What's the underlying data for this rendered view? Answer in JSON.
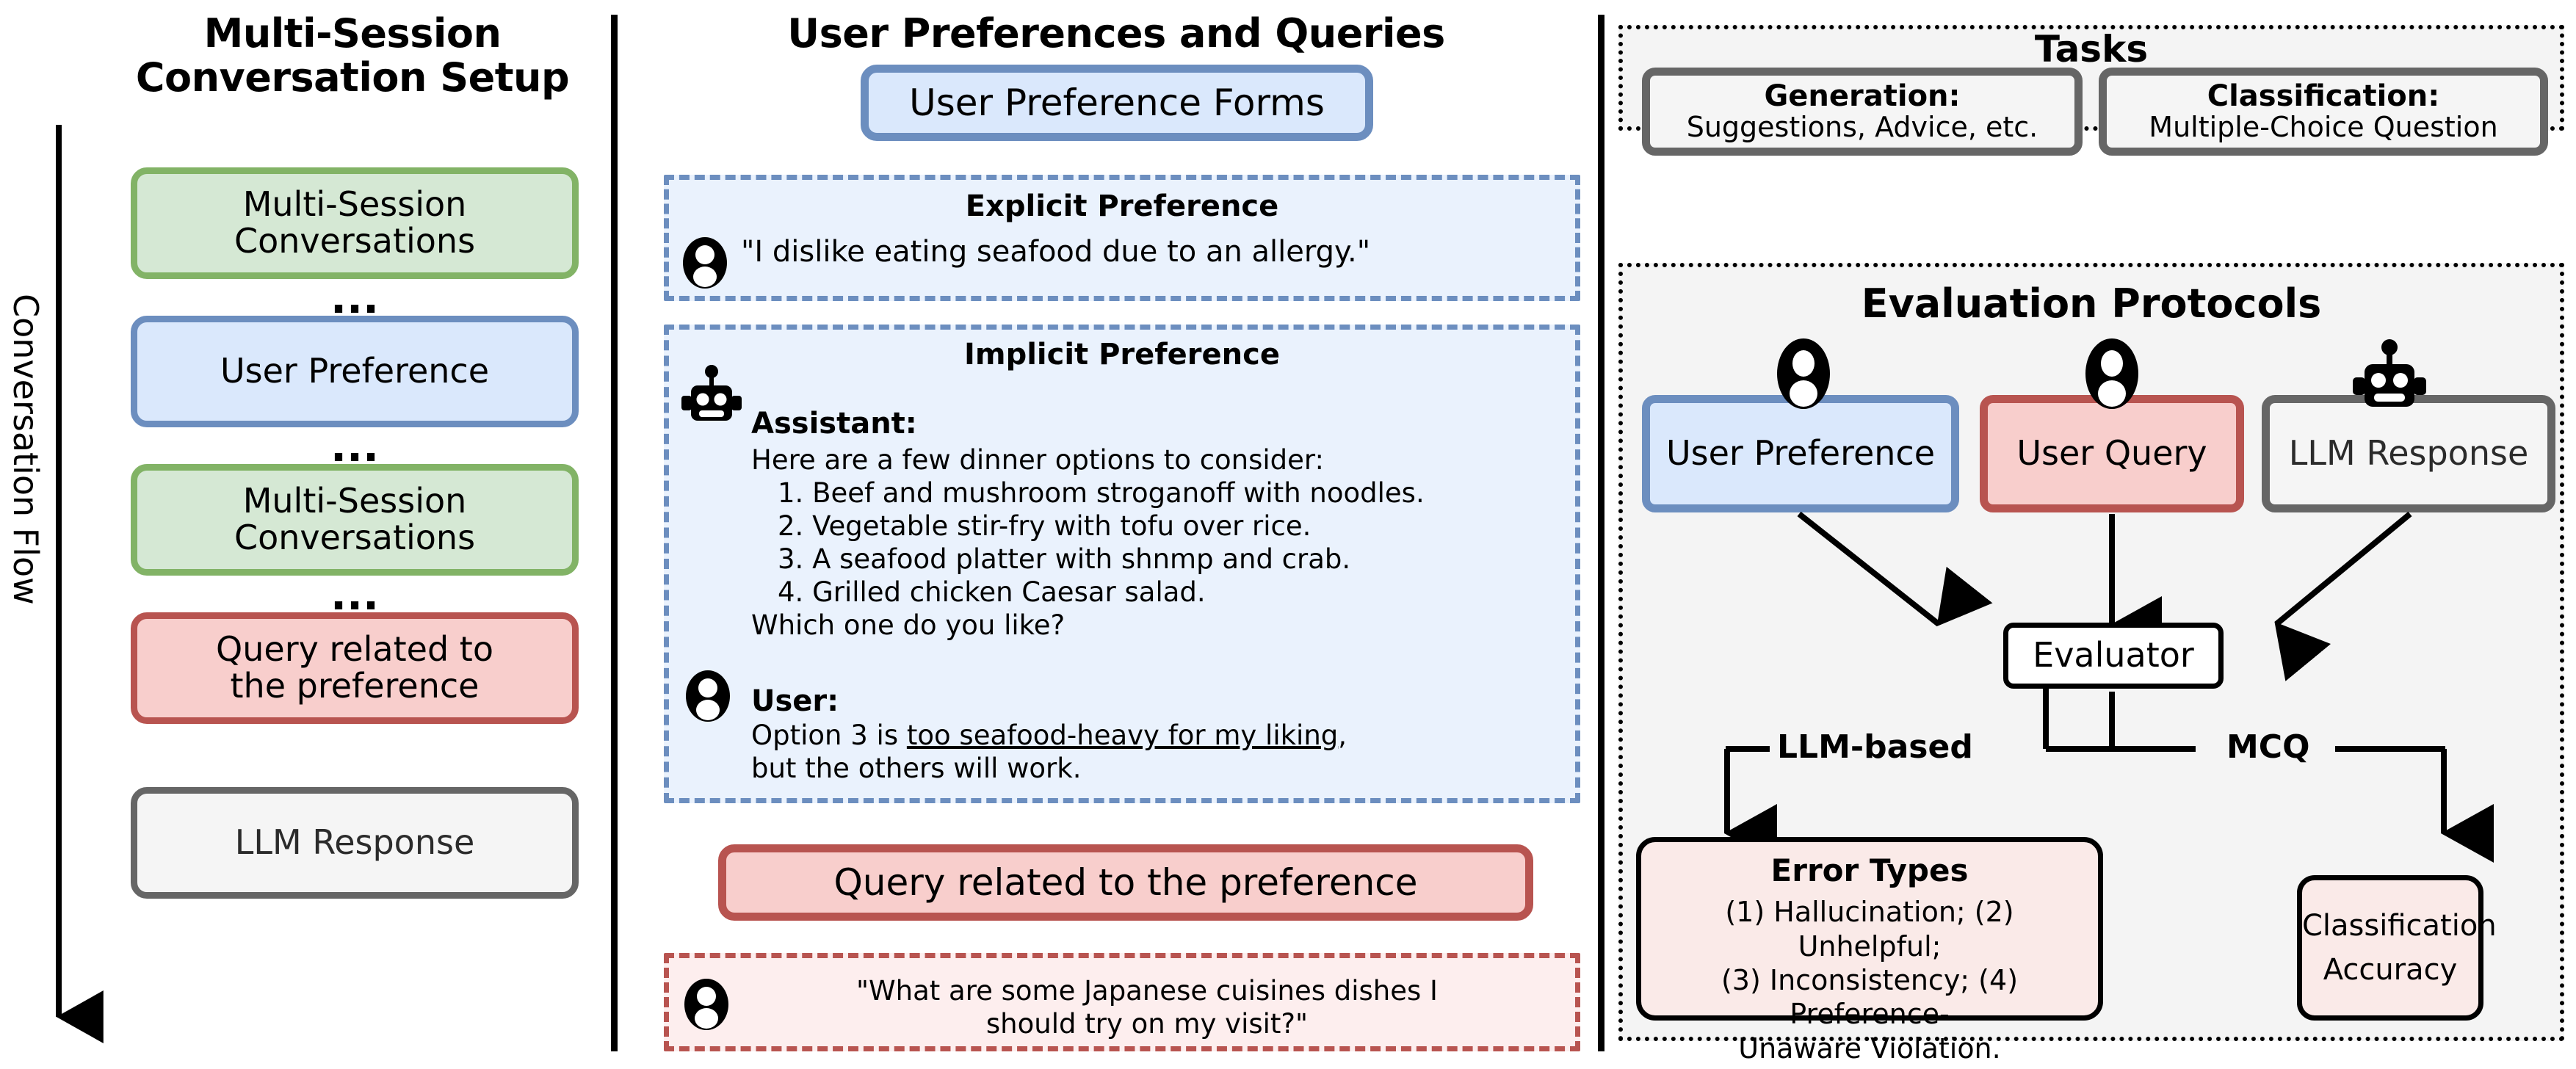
{
  "columns": {
    "left": {
      "title_line1": "Multi-Session",
      "title_line2": "Conversation Setup",
      "flow_label": "Conversation Flow",
      "ellipsis": "...",
      "items": [
        {
          "id": "msc-1",
          "label_line1": "Multi-Session",
          "label_line2": "Conversations",
          "color": "green"
        },
        {
          "id": "user-pref",
          "label_line1": "User Preference",
          "label_line2": "",
          "color": "blue"
        },
        {
          "id": "msc-2",
          "label_line1": "Multi-Session",
          "label_line2": "Conversations",
          "color": "green"
        },
        {
          "id": "query",
          "label_line1": "Query related to",
          "label_line2": "the preference",
          "color": "red"
        },
        {
          "id": "llm-response",
          "label_line1": "LLM Response",
          "label_line2": "",
          "color": "gray"
        }
      ]
    },
    "middle": {
      "title": "User Preferences and Queries",
      "forms_box": "User Preference Forms",
      "explicit": {
        "title": "Explicit Preference",
        "quote": "\"I dislike eating seafood due to an allergy.\""
      },
      "implicit": {
        "title": "Implicit Preference",
        "assistant_label": "Assistant:",
        "assistant_intro": "Here are a few dinner options to consider:",
        "options": [
          "1. Beef and mushroom stroganoff with noodles.",
          "2. Vegetable stir-fry with tofu over rice.",
          "3. A seafood platter with shnmp and crab.",
          "4. Grilled chicken Caesar salad."
        ],
        "assistant_outro": "Which one do you like?",
        "user_label": "User:",
        "user_line1_pre": "Option 3 is ",
        "user_line1_underlined": "too seafood-heavy for my liking",
        "user_line1_post": ",",
        "user_line2": "but the others will work."
      },
      "query_box": "Query related to the preference",
      "query_quote_line1": "\"What are some Japanese cuisines dishes I",
      "query_quote_line2": "should try on my visit?\""
    },
    "right": {
      "tasks": {
        "title": "Tasks",
        "cards": [
          {
            "heading": "Generation:",
            "body": "Suggestions, Advice, etc."
          },
          {
            "heading": "Classification:",
            "body": "Multiple-Choice Question"
          }
        ]
      },
      "protocols": {
        "title": "Evaluation Protocols",
        "inputs": [
          {
            "label": "User Preference",
            "icon": "user-icon",
            "color": "blue"
          },
          {
            "label": "User Query",
            "icon": "user-icon",
            "color": "red"
          },
          {
            "label": "LLM Response",
            "icon": "robot-icon",
            "color": "gray"
          }
        ],
        "evaluator": "Evaluator",
        "branch_left": "LLM-based",
        "branch_right": "MCQ",
        "error_types": {
          "title": "Error Types",
          "line1": "(1) Hallucination; (2) Unhelpful;",
          "line2": "(3) Inconsistency; (4) Preference-",
          "line3": "Unaware Violation."
        },
        "accuracy": {
          "line1": "Classification",
          "line2": "Accuracy"
        }
      }
    }
  },
  "colors": {
    "green_fill": "#d5e8d4",
    "green_stroke": "#82b366",
    "blue_fill": "#dae8fc",
    "blue_stroke": "#6c8ebf",
    "red_fill": "#f8cecc",
    "red_stroke": "#b85450",
    "gray_fill": "#f5f5f5",
    "gray_stroke": "#666666",
    "panel_fill": "#f4f4f4",
    "pink_fill": "#faeae8",
    "dash_blue_fill": "#eaf2fd",
    "dash_red_fill": "#fdeeee"
  }
}
